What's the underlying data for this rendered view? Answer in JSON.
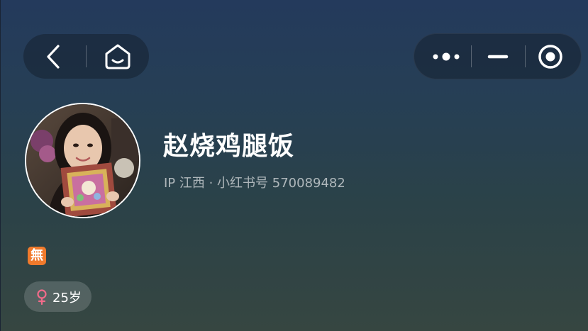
{
  "profile": {
    "name": "赵烧鸡腿饭",
    "meta": "IP 江西 · 小红书号 570089482",
    "badge_char": "無",
    "age": "25岁"
  },
  "icons": {
    "back": "back-chevron-icon",
    "home": "home-icon",
    "more": "more-dots-icon",
    "minimize": "minimize-icon",
    "close": "close-target-icon",
    "gender": "female-icon"
  },
  "colors": {
    "badge": "#f07a2c",
    "female": "#f26b8a",
    "background_top": "#243a5c",
    "background_bottom": "#364641"
  }
}
